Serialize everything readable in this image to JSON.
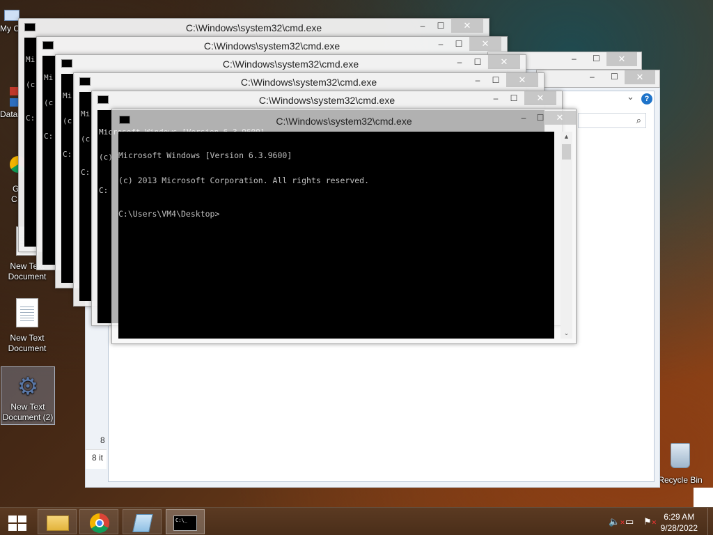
{
  "desktop": {
    "icons": [
      {
        "label": "My C"
      },
      {
        "label": "Data"
      },
      {
        "label": "G"
      },
      {
        "label": "C"
      },
      {
        "label": "New Text Document"
      },
      {
        "label": "New Text Document"
      },
      {
        "label": "New Text Document (2)"
      },
      {
        "label": "Recycle Bin"
      }
    ]
  },
  "cmd": {
    "title": "C:\\Windows\\system32\\cmd.exe",
    "minimize": "–",
    "maximize": "☐",
    "close": "✕",
    "header_line1": "Microsoft Windows [Version 6.3.9600]",
    "header_line2": "(c) 2013 Microsoft Corporation. All rights reserved.",
    "prompt": "C:\\Users\\VM4\\Desktop>",
    "bg_stub_line1": "Mi",
    "bg_stub_line2": "(c",
    "bg_stub_line3": "C:"
  },
  "explorer": {
    "status_items": "8 it",
    "status_count": "8",
    "help_icon": "?",
    "chevron_icon": "⌄",
    "search_icon": "⌕"
  },
  "taskbar": {
    "clock_time": "6:29 AM",
    "clock_date": "9/28/2022",
    "cmd_icon_text": "C:\\_"
  },
  "colors": {
    "console_bg": "#000000",
    "console_fg": "#c0c0c0",
    "taskbar_bg": "#4a2e19"
  }
}
